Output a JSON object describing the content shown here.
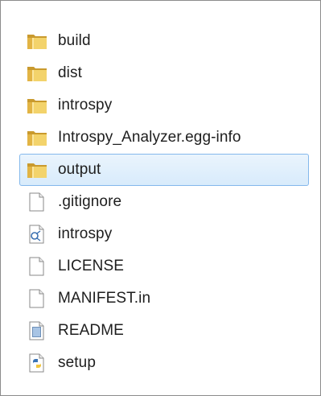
{
  "explorer": {
    "items": [
      {
        "label": "build",
        "icon": "folder-icon",
        "selected": false
      },
      {
        "label": "dist",
        "icon": "folder-icon",
        "selected": false
      },
      {
        "label": "introspy",
        "icon": "folder-icon",
        "selected": false
      },
      {
        "label": "Introspy_Analyzer.egg-info",
        "icon": "folder-icon",
        "selected": false
      },
      {
        "label": "output",
        "icon": "folder-icon",
        "selected": true
      },
      {
        "label": ".gitignore",
        "icon": "blank-file-icon",
        "selected": false
      },
      {
        "label": "introspy",
        "icon": "script-file-icon",
        "selected": false
      },
      {
        "label": "LICENSE",
        "icon": "blank-file-icon",
        "selected": false
      },
      {
        "label": "MANIFEST.in",
        "icon": "blank-file-icon",
        "selected": false
      },
      {
        "label": "README",
        "icon": "text-file-icon",
        "selected": false
      },
      {
        "label": "setup",
        "icon": "python-file-icon",
        "selected": false
      }
    ]
  },
  "colors": {
    "selection_fill": "#d8ebfb",
    "selection_border": "#84b8ec",
    "folder": "#e8c250",
    "text": "#1e1e1e"
  }
}
